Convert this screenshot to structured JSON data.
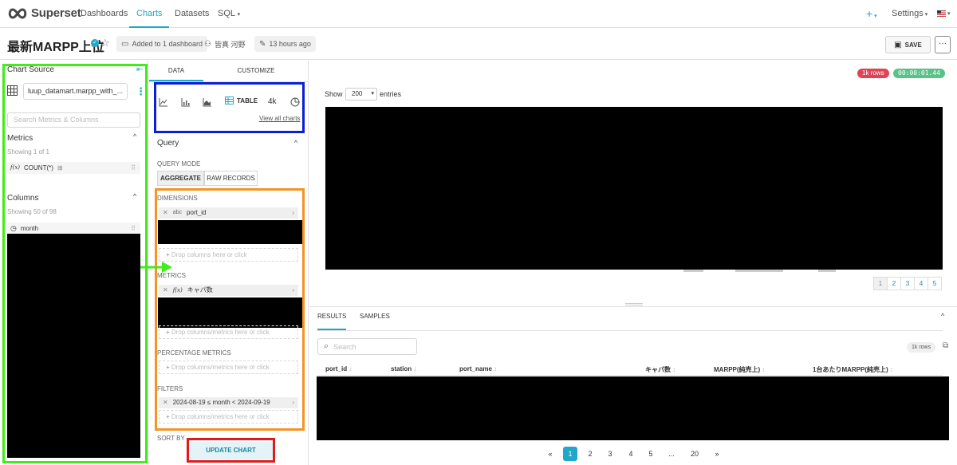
{
  "topnav": {
    "brand": "Superset",
    "links": [
      "Dashboards",
      "Charts",
      "Datasets",
      "SQL"
    ],
    "active": "Charts",
    "plus": "+",
    "settings": "Settings"
  },
  "titlebar": {
    "title": "最新MARPP上位",
    "added_to": "Added to 1 dashboard",
    "owner": "皆真 河野",
    "modified": "13 hours ago",
    "save": "SAVE",
    "more": "···"
  },
  "left": {
    "chart_source": "Chart Source",
    "dataset": "luup_datamart.marpp_with_...",
    "search_placeholder": "Search Metrics & Columns",
    "metrics_heading": "Metrics",
    "metrics_showing": "Showing 1 of 1",
    "metric_item": "COUNT(*)",
    "columns_heading": "Columns",
    "columns_showing": "Showing 50 of 98",
    "column_item": "month"
  },
  "middle": {
    "tabs": [
      "DATA",
      "CUSTOMIZE"
    ],
    "table_label": "TABLE",
    "k4_label": "4k",
    "view_all": "View all charts",
    "query_heading": "Query",
    "query_mode_label": "QUERY MODE",
    "query_modes": [
      "AGGREGATE",
      "RAW RECORDS"
    ],
    "dimensions_label": "DIMENSIONS",
    "dimension_pill": "port_id",
    "dimension_type": "abc",
    "drop_columns": "Drop columns here or click",
    "metrics_label": "METRICS",
    "metric_pill": "キャパ数",
    "drop_metrics": "Drop columns/metrics here or click",
    "pct_metrics_label": "PERCENTAGE METRICS",
    "drop_pct_metrics": "Drop columns/metrics here or click",
    "filters_label": "FILTERS",
    "filter_pill": "2024-08-19 ≤ month < 2024-09-19",
    "drop_filters": "Drop columns/metrics here or click",
    "sort_by_label": "SORT BY",
    "update_chart": "UPDATE CHART"
  },
  "right": {
    "rows_badge": "1k rows",
    "time_badge": "00:00:01.44",
    "show_label": "Show",
    "entries_value": "200",
    "entries_label": "entries",
    "small_pages": [
      "1",
      "2",
      "3",
      "4",
      "5"
    ],
    "results_tab": "RESULTS",
    "samples_tab": "SAMPLES",
    "search_placeholder": "Search",
    "rows_pill": "1k rows",
    "columns": [
      "port_id",
      "station",
      "port_name",
      "キャパ数",
      "MARPP(純売上)",
      "1台あたりMARPP(純売上)"
    ],
    "pages": [
      "«",
      "1",
      "2",
      "3",
      "4",
      "5",
      "...",
      "20",
      "»"
    ]
  },
  "colors": {
    "accent": "#20a7c9",
    "badge_red": "#e04355",
    "badge_green": "#5ac189",
    "anno_green": "#41ec1a",
    "anno_blue": "#0a1fd6",
    "anno_orange": "#f39425",
    "anno_red": "#e01a1a"
  }
}
